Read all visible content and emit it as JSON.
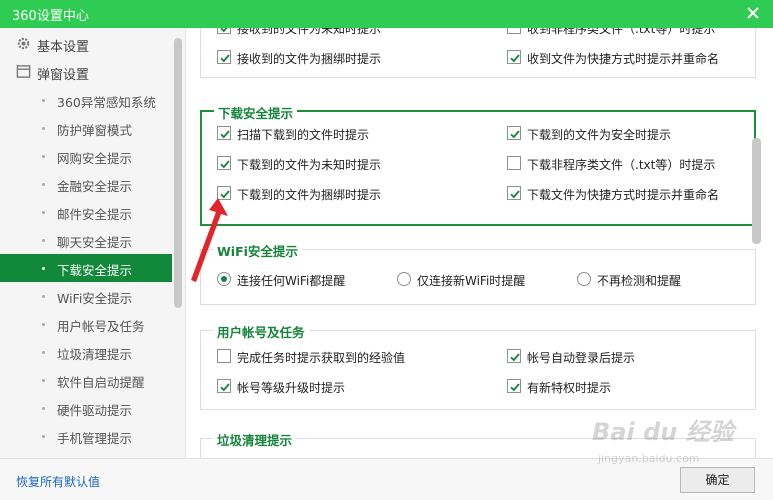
{
  "window": {
    "title": "360设置中心"
  },
  "sidebar": {
    "groups": [
      {
        "label": "基本设置",
        "icon": "gear-icon"
      },
      {
        "label": "弹窗设置",
        "icon": "window-icon"
      }
    ],
    "items": [
      {
        "label": "360异常感知系统",
        "active": false
      },
      {
        "label": "防护弹窗模式",
        "active": false
      },
      {
        "label": "网购安全提示",
        "active": false
      },
      {
        "label": "金融安全提示",
        "active": false
      },
      {
        "label": "邮件安全提示",
        "active": false
      },
      {
        "label": "聊天安全提示",
        "active": false
      },
      {
        "label": "下载安全提示",
        "active": true
      },
      {
        "label": "WiFi安全提示",
        "active": false
      },
      {
        "label": "用户帐号及任务",
        "active": false
      },
      {
        "label": "垃圾清理提示",
        "active": false
      },
      {
        "label": "软件自启动提醒",
        "active": false
      },
      {
        "label": "硬件驱动提示",
        "active": false
      },
      {
        "label": "手机管理提示",
        "active": false
      }
    ]
  },
  "sections": {
    "chat_top": {
      "options": [
        {
          "label": "接收到的文件为未知时提示",
          "checked": true
        },
        {
          "label": "收到非程序类文件（.txt等）时提示",
          "checked": false
        },
        {
          "label": "接收到的文件为捆绑时提示",
          "checked": true
        },
        {
          "label": "收到文件为快捷方式时提示并重命名",
          "checked": true
        }
      ]
    },
    "download": {
      "title": "下载安全提示",
      "options": [
        {
          "label": "扫描下载到的文件时提示",
          "checked": true
        },
        {
          "label": "下载到的文件为安全时提示",
          "checked": true
        },
        {
          "label": "下载到的文件为未知时提示",
          "checked": true
        },
        {
          "label": "下载非程序类文件（.txt等）时提示",
          "checked": false
        },
        {
          "label": "下载到的文件为捆绑时提示",
          "checked": true
        },
        {
          "label": "下载文件为快捷方式时提示并重命名",
          "checked": true
        }
      ]
    },
    "wifi": {
      "title": "WiFi安全提示",
      "options": [
        {
          "label": "连接任何WiFi都提醒",
          "selected": true
        },
        {
          "label": "仅连接新WiFi时提醒",
          "selected": false
        },
        {
          "label": "不再检测和提醒",
          "selected": false
        }
      ]
    },
    "account": {
      "title": "用户帐号及任务",
      "options": [
        {
          "label": "完成任务时提示获取到的经验值",
          "checked": false
        },
        {
          "label": "帐号自动登录后提示",
          "checked": true
        },
        {
          "label": "帐号等级升级时提示",
          "checked": true
        },
        {
          "label": "有新特权时提示",
          "checked": true
        }
      ]
    },
    "junk": {
      "title": "垃圾清理提示"
    }
  },
  "footer": {
    "restore_label": "恢复所有默认值",
    "ok_label": "确定"
  },
  "watermark": {
    "text": "Bai du 经验",
    "sub": "jingyan.baidu.com"
  },
  "colors": {
    "titlebar": "#2ecc52",
    "accent": "#16843a",
    "active_item": "#11883a",
    "annotation": "#e0262a"
  }
}
